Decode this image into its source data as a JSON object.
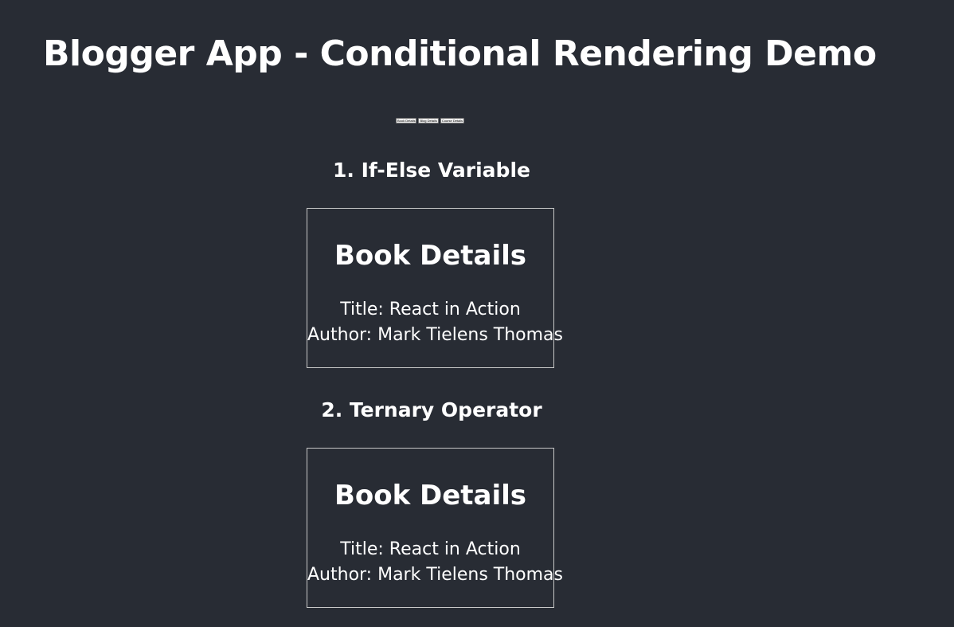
{
  "app": {
    "title": "Blogger App - Conditional Rendering Demo"
  },
  "toolbar": {
    "buttons": [
      {
        "label": "Book Details"
      },
      {
        "label": "Blog Details"
      },
      {
        "label": "Course Details"
      }
    ]
  },
  "sections": [
    {
      "heading": "1. If-Else Variable",
      "card": {
        "heading": "Book Details",
        "title_line": "Title: React in Action",
        "author_line": "Author: Mark Tielens Thomas"
      }
    },
    {
      "heading": "2. Ternary Operator",
      "card": {
        "heading": "Book Details",
        "title_line": "Title: React in Action",
        "author_line": "Author: Mark Tielens Thomas"
      }
    }
  ],
  "colors": {
    "background": "#282c34",
    "text": "#ffffff",
    "card_border": "#c8c8c8"
  }
}
